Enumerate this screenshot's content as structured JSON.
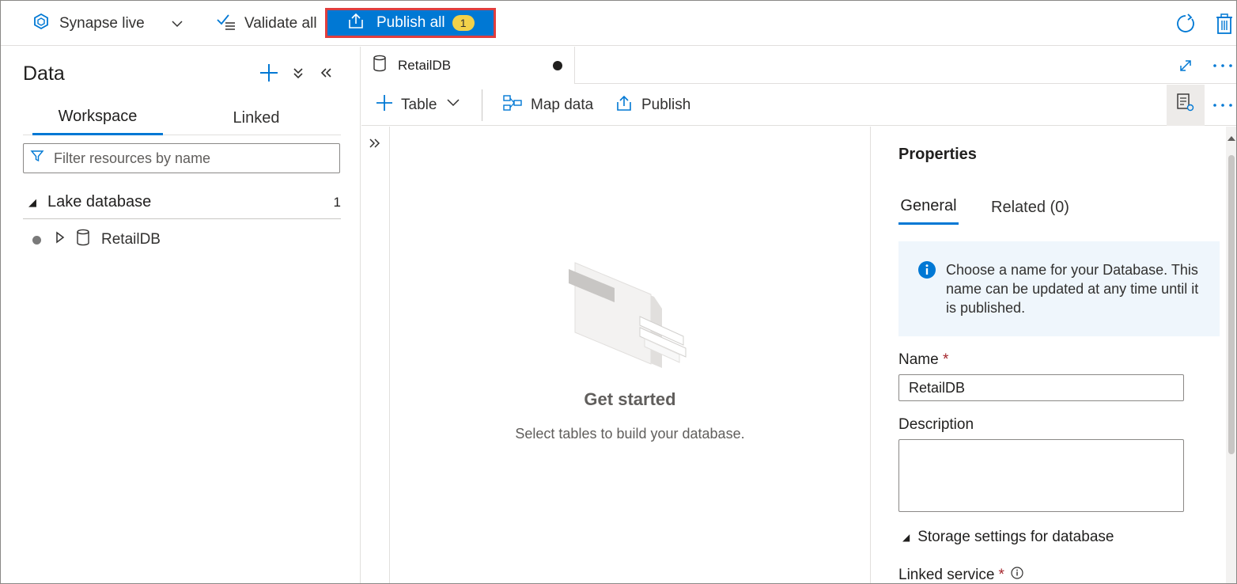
{
  "topbar": {
    "live_label": "Synapse live",
    "validate_label": "Validate all",
    "publish_label": "Publish all",
    "publish_count": "1"
  },
  "left_panel": {
    "title": "Data",
    "tabs": [
      "Workspace",
      "Linked"
    ],
    "filter_placeholder": "Filter resources by name",
    "section_label": "Lake database",
    "section_count": "1",
    "item_label": "RetailDB"
  },
  "editor": {
    "tab_label": "RetailDB",
    "toolbar": {
      "table_label": "Table",
      "map_label": "Map data",
      "publish_label": "Publish"
    },
    "empty_state": {
      "title": "Get started",
      "subtitle": "Select tables to build your database."
    }
  },
  "properties": {
    "title": "Properties",
    "tabs": [
      "General",
      "Related (0)"
    ],
    "info_text": "Choose a name for your Database. This name can be updated at any time until it is published.",
    "name_label": "Name",
    "required_mark": "*",
    "name_value": "RetailDB",
    "description_label": "Description",
    "description_value": "",
    "storage_label": "Storage settings for database",
    "linked_service_label": "Linked service"
  },
  "colors": {
    "accent": "#0078d4",
    "highlight_border": "#e03e3e",
    "badge": "#f2d14a",
    "info_bg": "#eff6fc",
    "required": "#a4262c"
  }
}
